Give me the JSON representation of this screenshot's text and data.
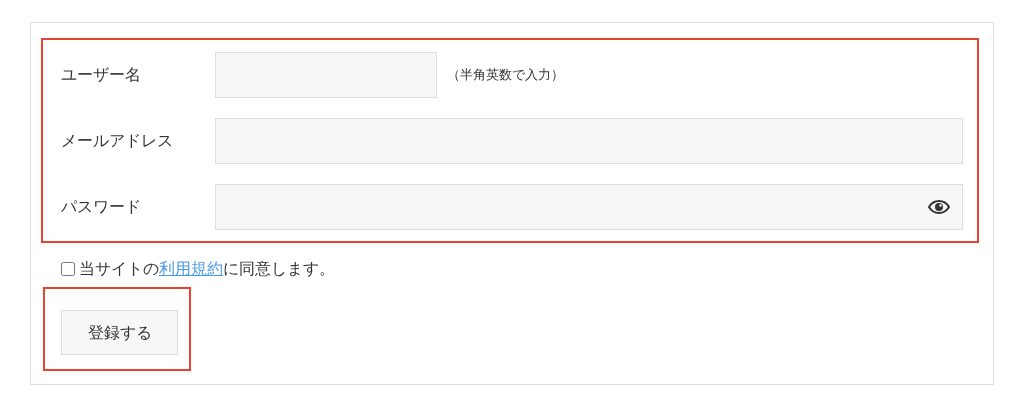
{
  "form_section": {
    "highlighted": true,
    "fields": [
      {
        "label": "ユーザー名",
        "kind": "short",
        "hint": "（半角英数で入力）"
      },
      {
        "label": "メールアドレス",
        "kind": "wide"
      },
      {
        "label": "パスワード",
        "kind": "password"
      }
    ]
  },
  "agreement": {
    "checked": false,
    "prefix": "当サイトの",
    "link": "利用規約",
    "suffix": "に同意します。"
  },
  "submit": {
    "label": "登録する",
    "highlighted": true
  }
}
